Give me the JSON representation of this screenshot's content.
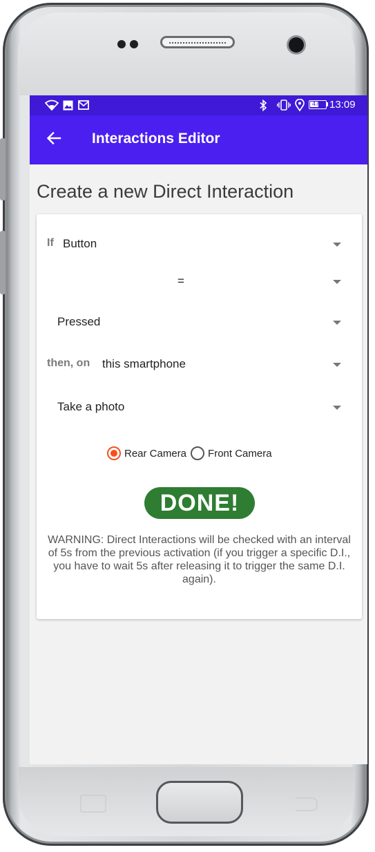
{
  "status_bar": {
    "icons_left": [
      "wifi-icon",
      "image-icon",
      "gmail-icon"
    ],
    "icons_right": [
      "bluetooth-icon",
      "vibrate-icon",
      "location-icon",
      "battery-icon"
    ],
    "battery": "47",
    "time": "13:09"
  },
  "app_bar": {
    "title": "Interactions Editor",
    "back_icon": "arrow-left-icon"
  },
  "page": {
    "heading": "Create a new Direct Interaction"
  },
  "form": {
    "if_label": "If",
    "if_value": "Button",
    "operator_value": "=",
    "state_value": "Pressed",
    "then_label": "then, on",
    "target_value": "this smartphone",
    "action_value": "Take a photo",
    "camera_options": [
      {
        "label": "Rear Camera",
        "selected": true
      },
      {
        "label": "Front Camera",
        "selected": false
      }
    ],
    "done_label": "DONE!",
    "warning": "WARNING: Direct Interactions will be checked with an interval of 5s from the previous activation (if you trigger a specific D.I., you have to wait 5s after releasing it to trigger the same D.I. again)."
  },
  "colors": {
    "status_bar": "#3f19d6",
    "app_bar": "#4a1ff0",
    "radio_accent": "#f4511e",
    "done_button": "#2e7d32"
  }
}
